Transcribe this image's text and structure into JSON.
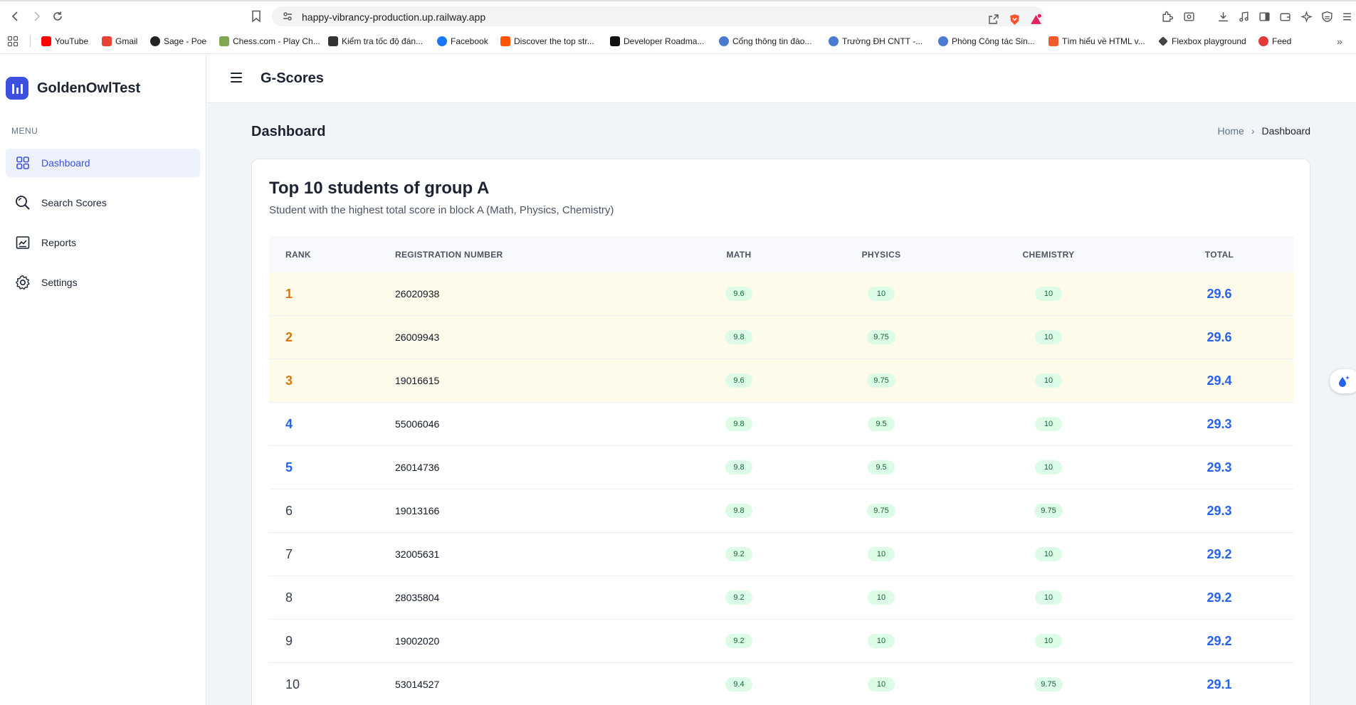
{
  "browser": {
    "url": "happy-vibrancy-production.up.railway.app",
    "bookmarks": [
      {
        "label": "YouTube",
        "color": "#ff0000"
      },
      {
        "label": "Gmail",
        "color": "#ea4335"
      },
      {
        "label": "Sage - Poe",
        "color": "#222222"
      },
      {
        "label": "Chess.com - Play Ch...",
        "color": "#7fa650"
      },
      {
        "label": "Kiểm tra tốc độ đán...",
        "color": "#333333"
      },
      {
        "label": "Facebook",
        "color": "#1877f2"
      },
      {
        "label": "Discover the top str...",
        "color": "#ff5500"
      },
      {
        "label": "Developer Roadma...",
        "color": "#111111"
      },
      {
        "label": "Cổng thông tin đào...",
        "color": "#4a7bd0"
      },
      {
        "label": "Trường ĐH CNTT -...",
        "color": "#4a7bd0"
      },
      {
        "label": "Phòng Công tác Sin...",
        "color": "#4a7bd0"
      },
      {
        "label": "Tìm hiểu về HTML v...",
        "color": "#f05a28"
      },
      {
        "label": "Flexbox playground",
        "color": "#444444"
      },
      {
        "label": "Feed",
        "color": "#e03a3a"
      }
    ]
  },
  "sidebar": {
    "brand": "GoldenOwlTest",
    "menu_label": "MENU",
    "items": [
      {
        "label": "Dashboard",
        "active": true
      },
      {
        "label": "Search Scores",
        "active": false
      },
      {
        "label": "Reports",
        "active": false
      },
      {
        "label": "Settings",
        "active": false
      }
    ]
  },
  "header": {
    "title": "G-Scores"
  },
  "main": {
    "page_title": "Dashboard",
    "breadcrumb": {
      "home": "Home",
      "current": "Dashboard"
    },
    "card": {
      "title": "Top 10 students of group A",
      "subtitle": "Student with the highest total score in block A (Math, Physics, Chemistry)",
      "columns": [
        "RANK",
        "REGISTRATION NUMBER",
        "MATH",
        "PHYSICS",
        "CHEMISTRY",
        "TOTAL"
      ],
      "rows": [
        {
          "rank": "1",
          "reg": "26020938",
          "math": "9.6",
          "physics": "10",
          "chemistry": "10",
          "total": "29.6"
        },
        {
          "rank": "2",
          "reg": "26009943",
          "math": "9.8",
          "physics": "9.75",
          "chemistry": "10",
          "total": "29.6"
        },
        {
          "rank": "3",
          "reg": "19016615",
          "math": "9.6",
          "physics": "9.75",
          "chemistry": "10",
          "total": "29.4"
        },
        {
          "rank": "4",
          "reg": "55006046",
          "math": "9.8",
          "physics": "9.5",
          "chemistry": "10",
          "total": "29.3"
        },
        {
          "rank": "5",
          "reg": "26014736",
          "math": "9.8",
          "physics": "9.5",
          "chemistry": "10",
          "total": "29.3"
        },
        {
          "rank": "6",
          "reg": "19013166",
          "math": "9.8",
          "physics": "9.75",
          "chemistry": "9.75",
          "total": "29.3"
        },
        {
          "rank": "7",
          "reg": "32005631",
          "math": "9.2",
          "physics": "10",
          "chemistry": "10",
          "total": "29.2"
        },
        {
          "rank": "8",
          "reg": "28035804",
          "math": "9.2",
          "physics": "10",
          "chemistry": "10",
          "total": "29.2"
        },
        {
          "rank": "9",
          "reg": "19002020",
          "math": "9.2",
          "physics": "10",
          "chemistry": "10",
          "total": "29.2"
        },
        {
          "rank": "10",
          "reg": "53014527",
          "math": "9.4",
          "physics": "10",
          "chemistry": "9.75",
          "total": "29.1"
        }
      ]
    }
  },
  "colors": {
    "accent": "#3c50e0",
    "gold": "#d97706",
    "blue": "#2563eb",
    "pill_bg": "#dcfce7",
    "pill_text": "#166534",
    "top3_bg": "#fffbeb"
  }
}
